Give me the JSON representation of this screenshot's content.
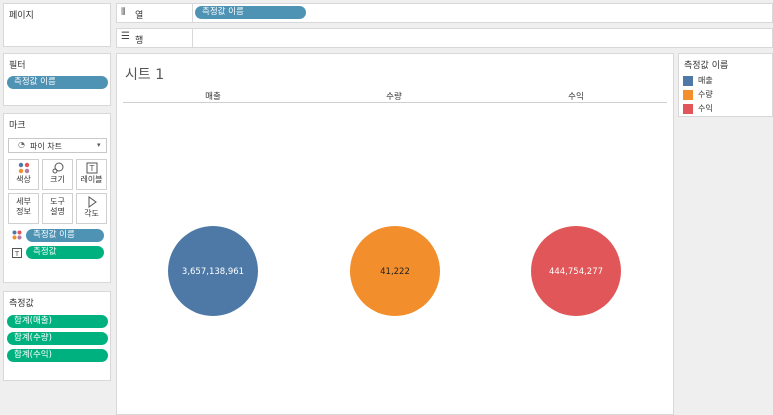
{
  "pages_card": {
    "title": "페이지"
  },
  "columns_shelf": {
    "label": "열",
    "icon": "columns-icon",
    "pill": "측정값 이름"
  },
  "rows_shelf": {
    "label": "행",
    "icon": "rows-icon"
  },
  "filters_card": {
    "title": "필터",
    "pill": "측정값 이름"
  },
  "marks_card": {
    "title": "마크",
    "mark_type": "파이 차트",
    "mark_type_icon": "pie-icon",
    "buttons": [
      {
        "label": "색상",
        "icon": "color-icon"
      },
      {
        "label": "크기",
        "icon": "size-icon"
      },
      {
        "label": "레이블",
        "icon": "label-icon"
      },
      {
        "label": "세부\n정보",
        "icon": "detail-icon"
      },
      {
        "label": "도구\n설명",
        "icon": "tooltip-icon"
      },
      {
        "label": "각도",
        "icon": "angle-icon"
      }
    ],
    "fields": [
      {
        "icon": "color-icon",
        "label": "측정값 이름"
      },
      {
        "icon": "label-icon",
        "label": "측정값"
      }
    ]
  },
  "measures_card": {
    "title": "측정값",
    "pills": [
      "합계(매출)",
      "합계(수량)",
      "합계(수익)"
    ]
  },
  "sheet": {
    "title": "시트 1"
  },
  "legend": {
    "title": "측정값 이름",
    "items": [
      {
        "label": "매출",
        "color": "#4e79a7"
      },
      {
        "label": "수량",
        "color": "#f28e2b"
      },
      {
        "label": "수익",
        "color": "#e15759"
      }
    ]
  },
  "chart_data": {
    "type": "pie",
    "categories": [
      "매출",
      "수량",
      "수익"
    ],
    "values": [
      3657138961,
      41222,
      444754277
    ],
    "value_labels": [
      "3,657,138,961",
      "41,222",
      "444,754,277"
    ],
    "colors": [
      "#4e79a7",
      "#f28e2b",
      "#e15759"
    ],
    "title": "시트 1"
  }
}
